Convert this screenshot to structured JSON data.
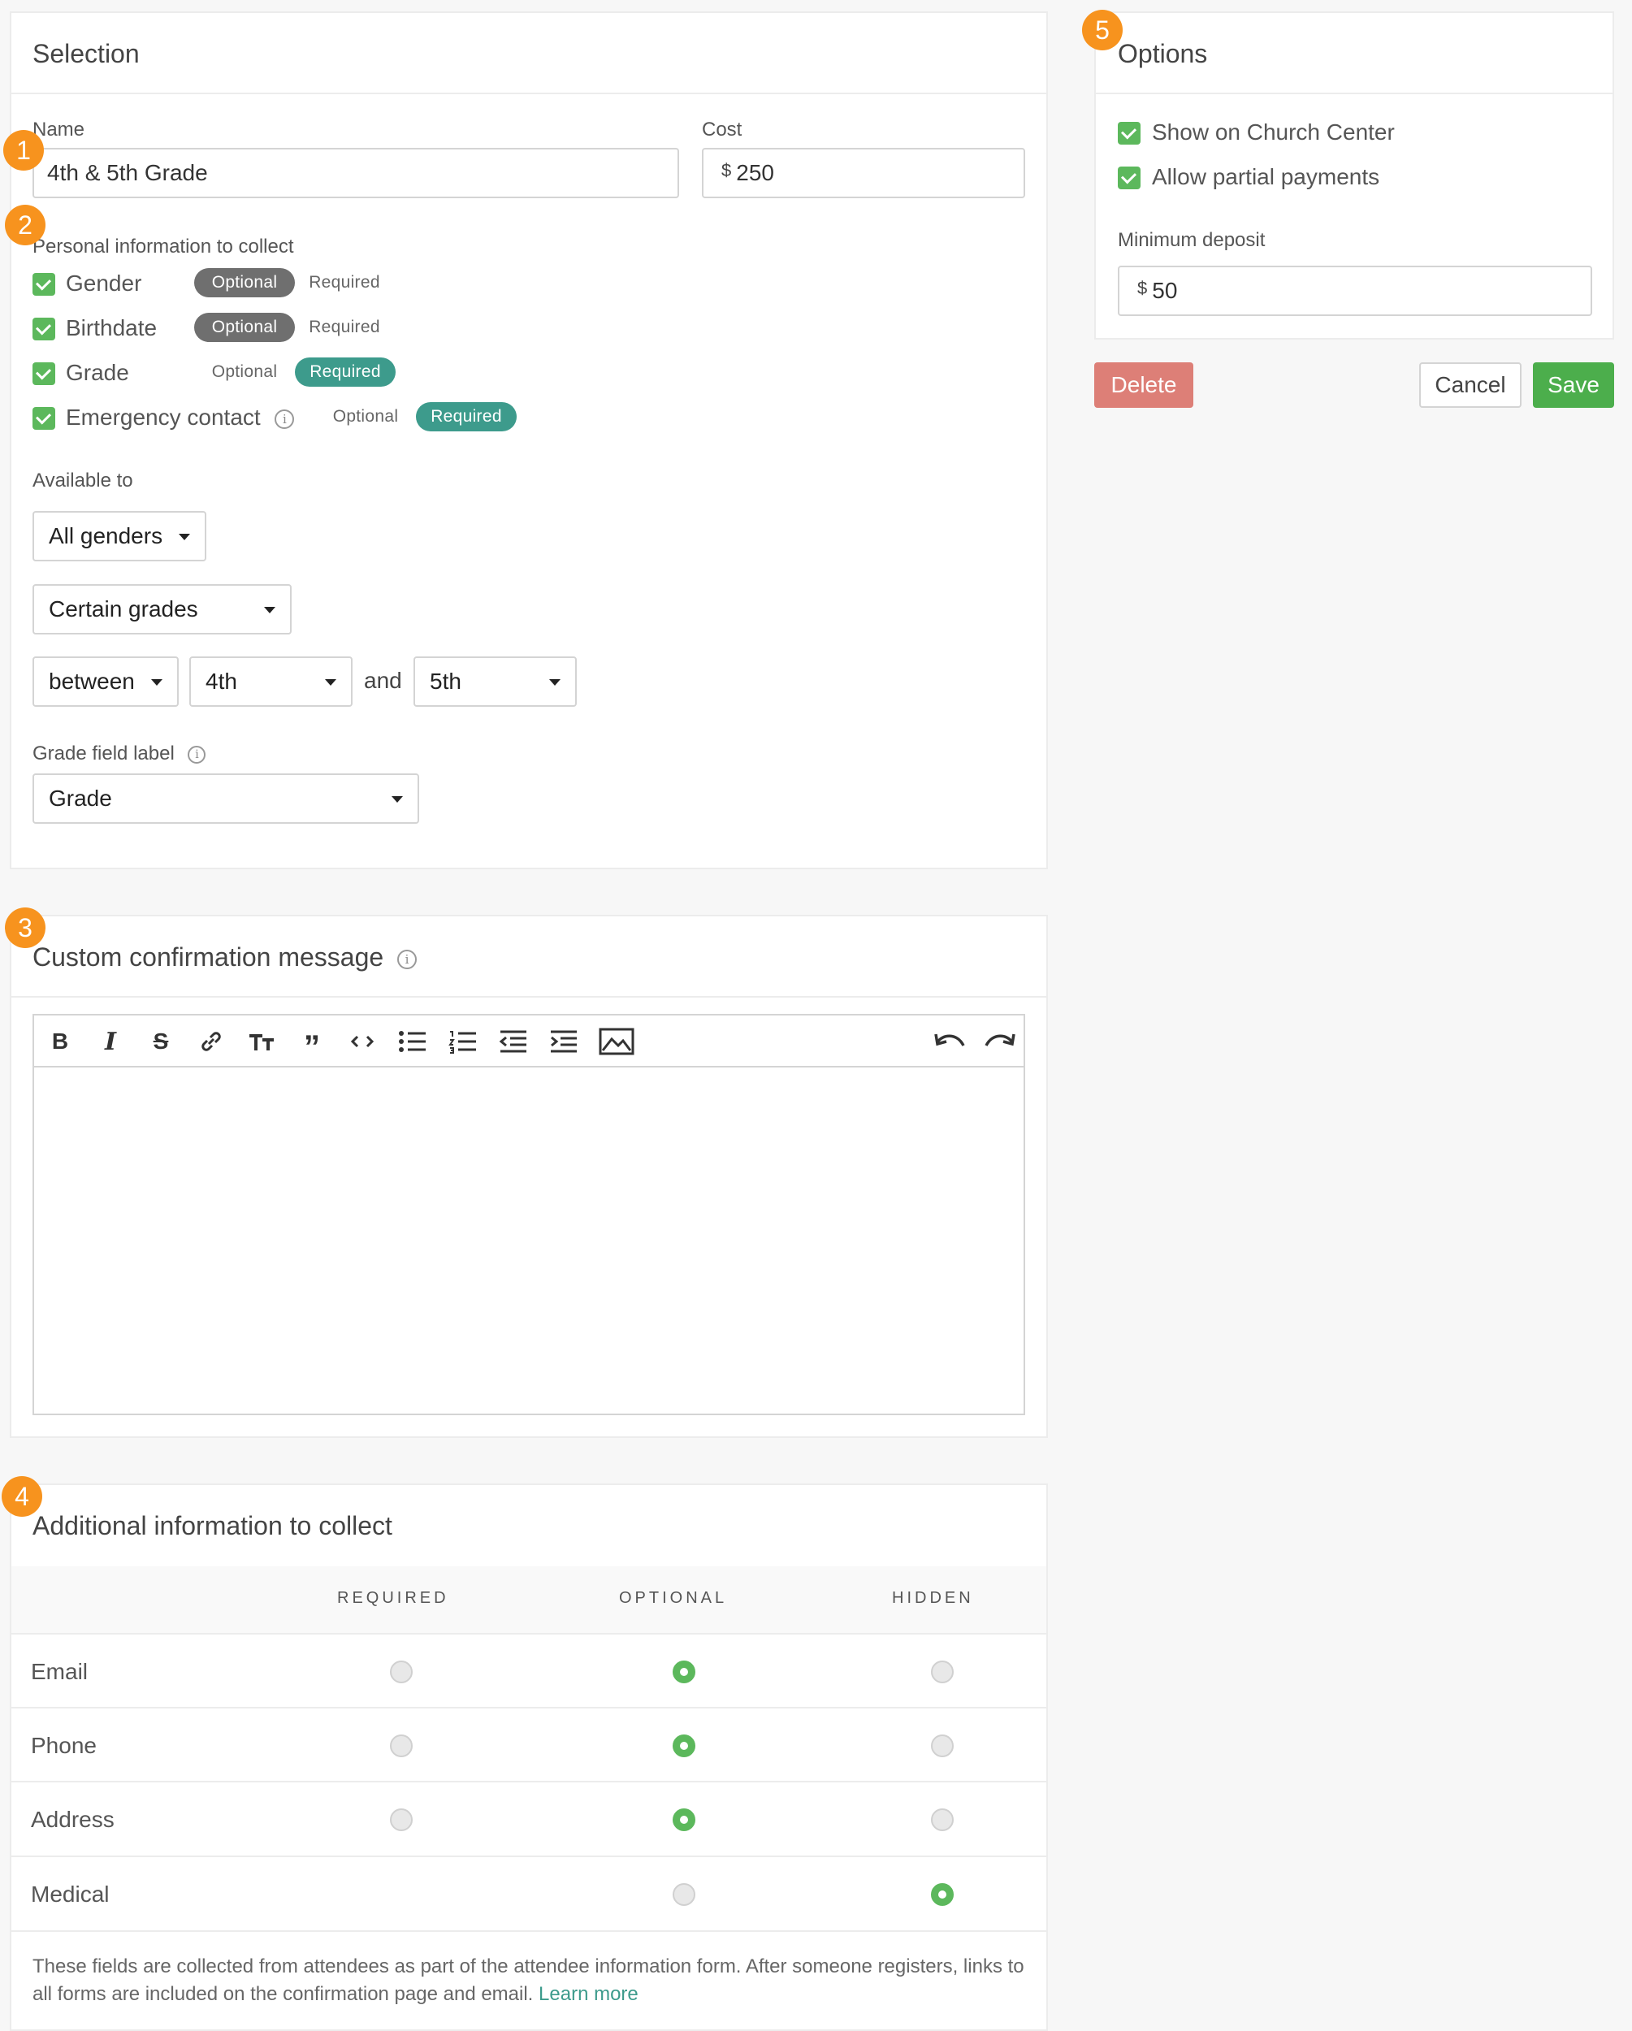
{
  "selection": {
    "title": "Selection",
    "name_label": "Name",
    "name_value": "4th & 5th Grade",
    "cost_label": "Cost",
    "currency": "$",
    "cost_value": "250",
    "personal_label": "Personal information to collect",
    "personal_items": [
      {
        "label": "Gender",
        "checked": true,
        "selected": "Optional"
      },
      {
        "label": "Birthdate",
        "checked": true,
        "selected": "Optional"
      },
      {
        "label": "Grade",
        "checked": true,
        "selected": "Required"
      },
      {
        "label": "Emergency contact",
        "checked": true,
        "selected": "Required",
        "info": true
      }
    ],
    "optional_label": "Optional",
    "required_label": "Required",
    "available_label": "Available to",
    "gender_select": "All genders",
    "grades_select": "Certain grades",
    "range_select": "between",
    "grade_from": "4th",
    "and_text": "and",
    "grade_to": "5th",
    "grade_field_label": "Grade field label",
    "grade_field_value": "Grade"
  },
  "confirmation": {
    "title": "Custom confirmation message",
    "toolbar": [
      "bold-icon",
      "italic-icon",
      "strikethrough-icon",
      "link-icon",
      "text-size-icon",
      "quote-icon",
      "code-icon",
      "bullet-list-icon",
      "numbered-list-icon",
      "outdent-icon",
      "indent-icon",
      "image-icon",
      "undo-icon",
      "redo-icon"
    ],
    "body_text": ""
  },
  "additional": {
    "title": "Additional information to collect",
    "columns": [
      "REQUIRED",
      "OPTIONAL",
      "HIDDEN"
    ],
    "rows": [
      {
        "label": "Email",
        "selected": "OPTIONAL"
      },
      {
        "label": "Phone",
        "selected": "OPTIONAL"
      },
      {
        "label": "Address",
        "selected": "OPTIONAL"
      },
      {
        "label": "Medical",
        "selected": "HIDDEN"
      }
    ],
    "footer_text": "These fields are collected from attendees as part of the attendee information form. After someone registers, links to all forms are included on the confirmation page and email.",
    "learn_more": "Learn more"
  },
  "options": {
    "title": "Options",
    "show_church_center": "Show on Church Center",
    "allow_partial": "Allow partial payments",
    "min_deposit_label": "Minimum deposit",
    "currency": "$",
    "min_deposit_value": "50"
  },
  "actions": {
    "delete": "Delete",
    "cancel": "Cancel",
    "save": "Save"
  },
  "badges": [
    "1",
    "2",
    "3",
    "4",
    "5"
  ],
  "colors": {
    "green": "#5cb85c",
    "teal": "#3d9b8c",
    "orange": "#f7931e",
    "delete": "#dd7f77",
    "link": "#3d9b8c"
  }
}
